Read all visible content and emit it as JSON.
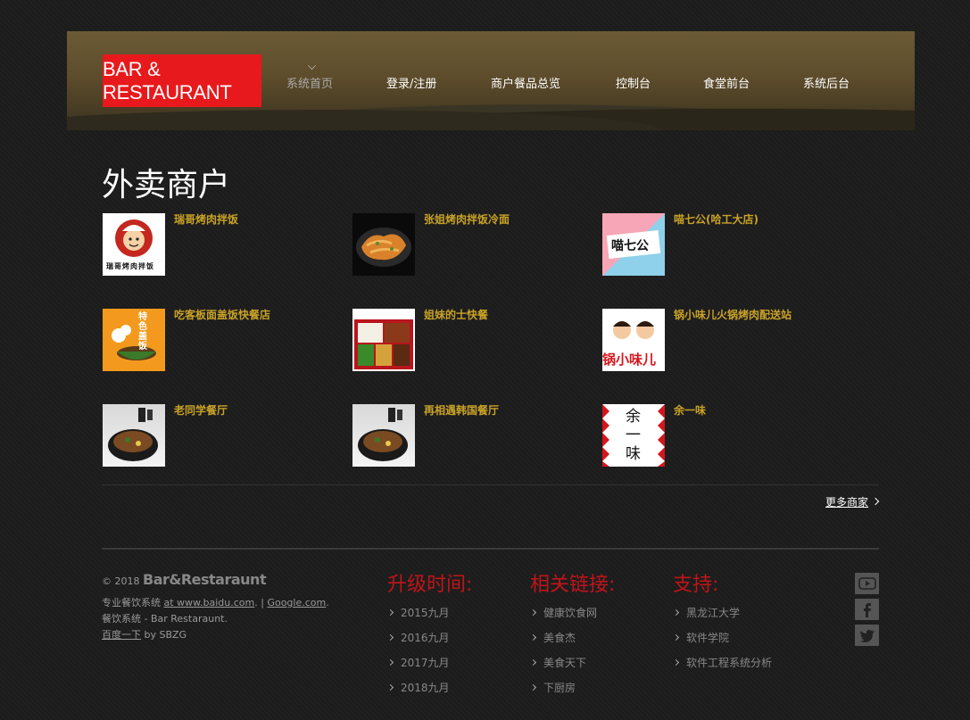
{
  "header": {
    "logo": "BAR & RESTAURANT",
    "nav": [
      {
        "label": "系统首页"
      },
      {
        "label": "登录/注册"
      },
      {
        "label": "商户餐品总览"
      },
      {
        "label": "控制台"
      },
      {
        "label": "食堂前台"
      },
      {
        "label": "系统后台"
      }
    ]
  },
  "main": {
    "title": "外卖商户",
    "merchants": [
      {
        "name": "瑞哥烤肉拌饭",
        "thumb_text": "瑞哥烤肉拌饭"
      },
      {
        "name": "张姐烤肉拌饭冷面"
      },
      {
        "name": "喵七公(哈工大店)",
        "thumb_text": "喵七公"
      },
      {
        "name": "吃客板面盖饭快餐店",
        "thumb_text": "特色盖饭"
      },
      {
        "name": "姐妹的士快餐"
      },
      {
        "name": "锅小味儿火锅烤肉配送站",
        "thumb_text": "锅小味儿"
      },
      {
        "name": "老同学餐厅"
      },
      {
        "name": "再相遇韩国餐厅"
      },
      {
        "name": "余一味",
        "thumb_text": "余一味"
      }
    ],
    "more_label": "更多商家"
  },
  "footer": {
    "copyright": "© 2018",
    "brand": "Bar&Restaraunt",
    "line1_prefix": "专业餐饮系统",
    "line1_link1": "at www.baidu.com",
    "line1_sep": ". |",
    "line1_link2": "Google.com",
    "line1_end": ".",
    "line2": "餐饮系统 - Bar Restaraunt.",
    "line3_link": "百度一下",
    "line3_rest": "by SBZG",
    "columns": [
      {
        "title": "升级时间:",
        "links": [
          "2015九月",
          "2016九月",
          "2017九月",
          "2018九月"
        ]
      },
      {
        "title": "相关链接:",
        "links": [
          "健康饮食网",
          "美食杰",
          "美食天下",
          "下厨房"
        ]
      },
      {
        "title": "支持:",
        "links": [
          "黑龙江大学",
          "软件学院",
          "软件工程系统分析"
        ]
      }
    ],
    "social": [
      {
        "icon": "youtube-icon"
      },
      {
        "icon": "facebook-icon"
      },
      {
        "icon": "twitter-icon"
      }
    ]
  }
}
